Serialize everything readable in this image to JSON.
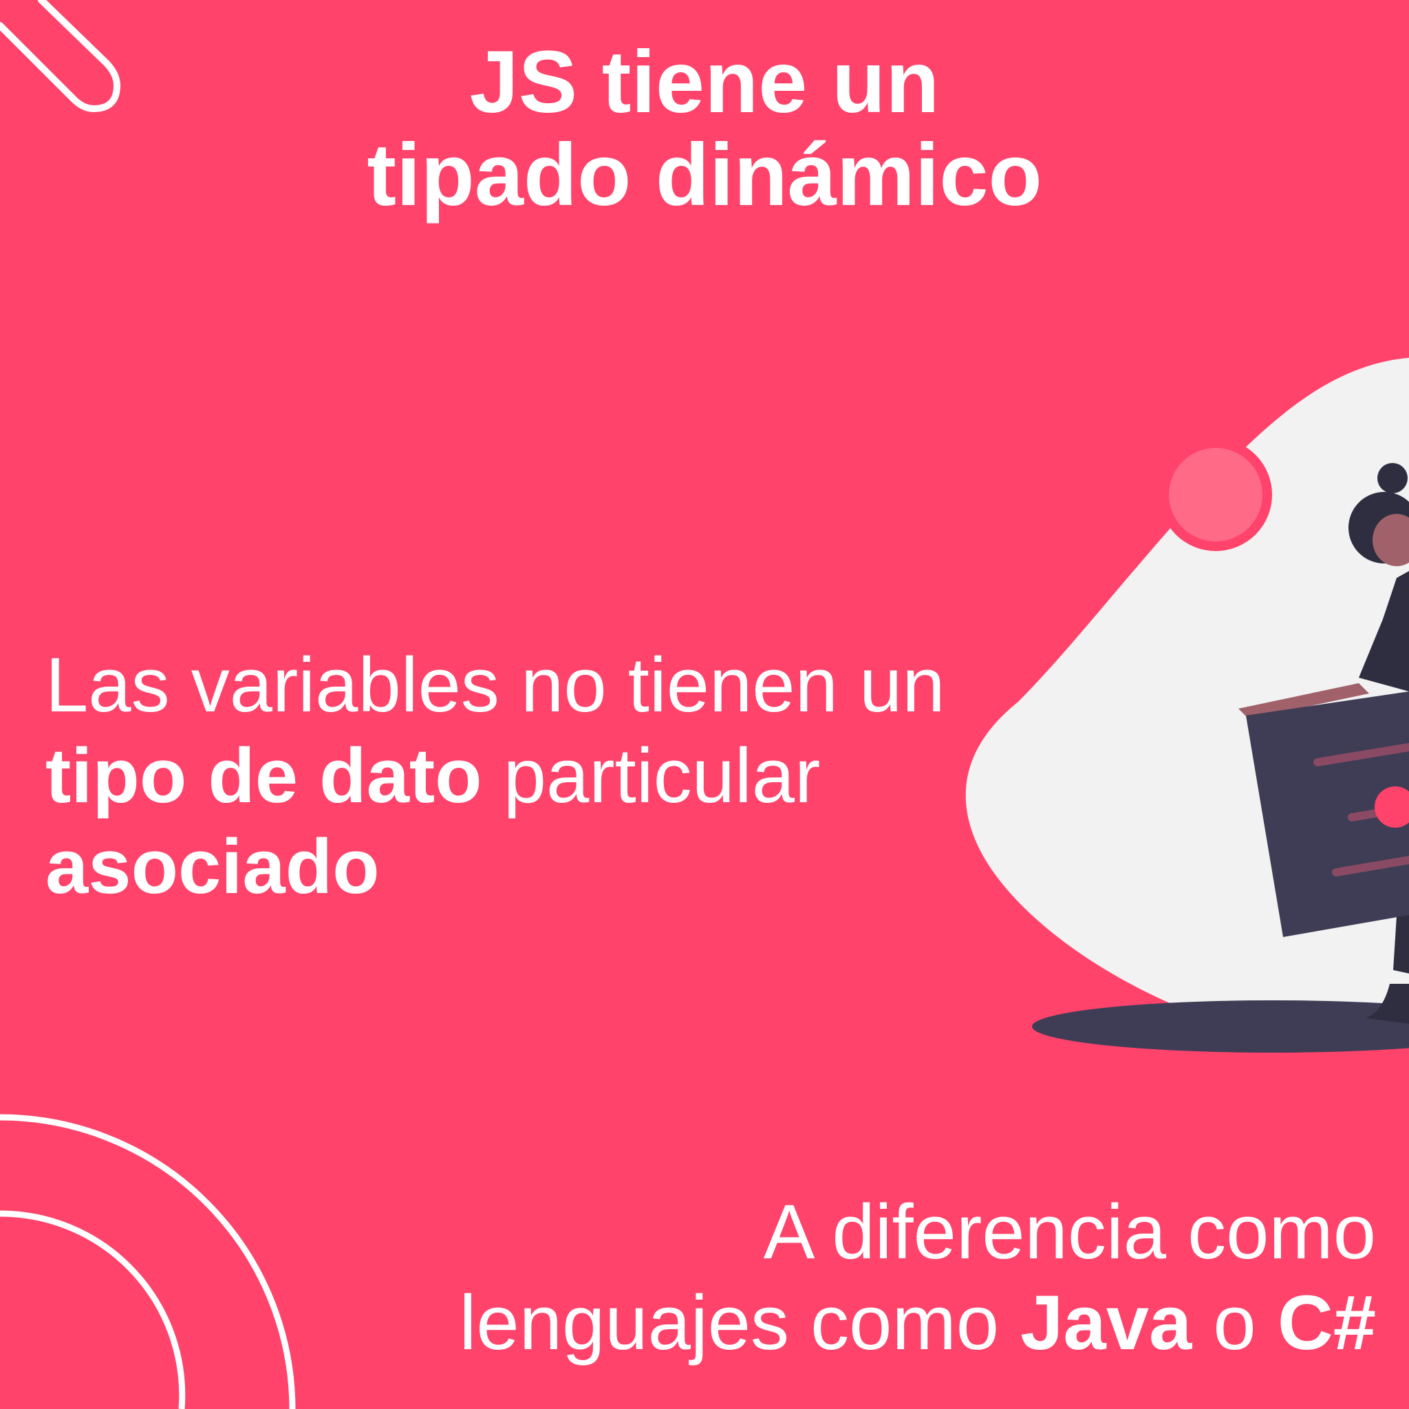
{
  "title": {
    "line1": "JS tiene un",
    "line2": "tipado dinámico"
  },
  "body": {
    "line1": "Las variables no tienen un",
    "line2_bold": "tipo de dato",
    "line2_rest": " particular",
    "line3_bold": "asociado"
  },
  "footer": {
    "line1": "A diferencia como",
    "line2_pre": "lenguajes como ",
    "line2_java": "Java",
    "line2_mid": " o ",
    "line2_cs": "C#"
  },
  "colors": {
    "background": "#FF436B",
    "text": "#ffffff",
    "blob": "#f2f2f2",
    "dark": "#3f3d56"
  }
}
